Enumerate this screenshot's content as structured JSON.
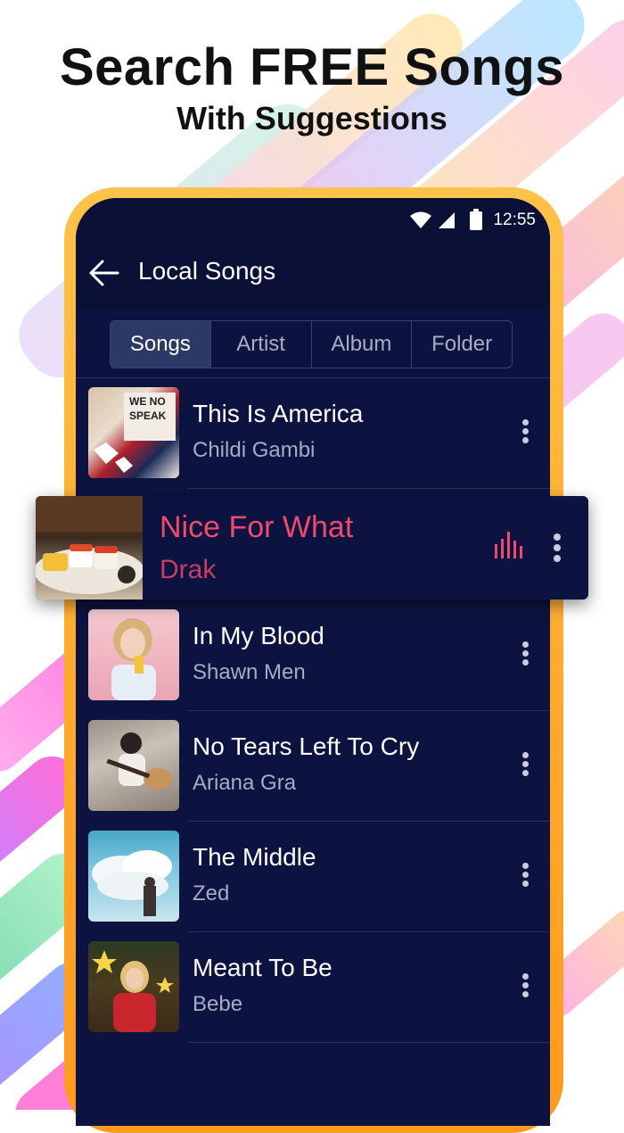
{
  "promo": {
    "headline": "Search FREE Songs",
    "subheadline": "With Suggestions"
  },
  "status_bar": {
    "time": "12:55",
    "icons": [
      "wifi-icon",
      "signal-icon",
      "battery-icon"
    ]
  },
  "app_bar": {
    "title": "Local Songs",
    "back_icon": "arrow-left-icon"
  },
  "tabs": [
    {
      "label": "Songs",
      "active": true
    },
    {
      "label": "Artist",
      "active": false
    },
    {
      "label": "Album",
      "active": false
    },
    {
      "label": "Folder",
      "active": false
    }
  ],
  "songs": [
    {
      "title": "This Is America",
      "artist": "Childi Gambi"
    },
    {
      "title": "Nice For What",
      "artist": "Drak",
      "playing": true
    },
    {
      "title": "In My Blood",
      "artist": "Shawn Men"
    },
    {
      "title": "No Tears Left To Cry",
      "artist": "Ariana Gra"
    },
    {
      "title": "The Middle",
      "artist": "Zed"
    },
    {
      "title": "Meant To Be",
      "artist": "Bebe"
    }
  ],
  "colors": {
    "screen_bg": "#0c1340",
    "accent_playing": "#ee4a6e",
    "phone_frame": "#ffb33a"
  }
}
